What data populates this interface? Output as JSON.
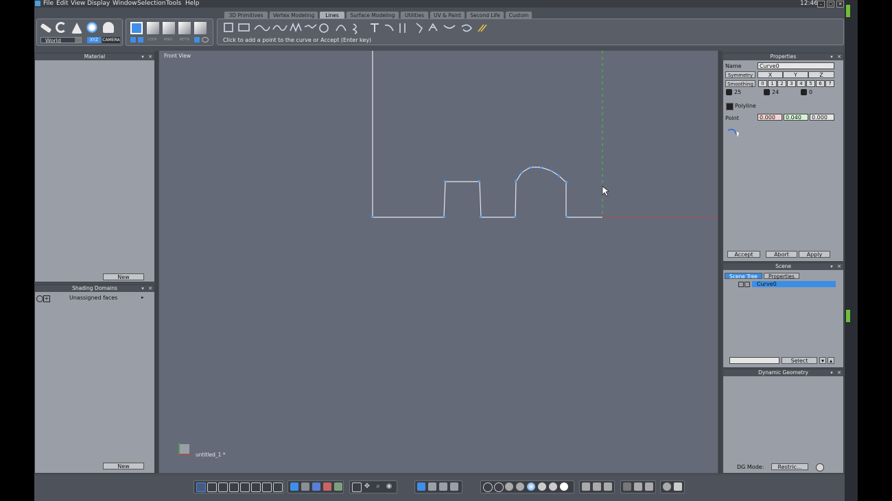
{
  "menu": {
    "items": [
      "File",
      "Edit",
      "View",
      "Display",
      "Window",
      "Selection",
      "Tools",
      "Help"
    ],
    "clock": "12:46"
  },
  "tabs": [
    "3D Primitives",
    "Vertex Modeling",
    "Lines",
    "Surface Modeling",
    "Utilities",
    "UV & Paint",
    "Second Life",
    "Custom"
  ],
  "active_tab": "Lines",
  "toolbar": {
    "space_select": "World",
    "xyz": "XYZ",
    "camera": "CAMERA",
    "loop": "LOOP",
    "ring": "RING",
    "betw": "BETW",
    "hint": "Click to add a point to the curve or Accept (Enter key)"
  },
  "material": {
    "title": "Material",
    "new_label": "New"
  },
  "shading": {
    "title": "Shading Domains",
    "item": "Unassigned faces",
    "new_label": "New"
  },
  "viewport": {
    "title": "Front View",
    "file": "untitled_1 *"
  },
  "properties": {
    "title": "Properties",
    "name_label": "Name",
    "name_value": "Curve0",
    "symmetry": "Symmetry",
    "axes": [
      "X",
      "Y",
      "Z"
    ],
    "smoothing": "Smoothing",
    "smooth_levels": [
      "0",
      "1",
      "2",
      "3",
      "4",
      "5",
      "6",
      "7"
    ],
    "counts": [
      "25",
      "24",
      "0"
    ],
    "polyline": "Polyline",
    "point_label": "Point",
    "point": [
      "0.000",
      "0.040",
      "0.000"
    ],
    "accept": "Accept",
    "abort": "Abort",
    "apply": "Apply"
  },
  "scene": {
    "title": "Scene",
    "tabs": [
      "Scene Tree",
      "Properties"
    ],
    "item": "Curve0",
    "select": "Select"
  },
  "dynamic": {
    "title": "Dynamic Geometry",
    "dg_label": "DG Mode:",
    "dg_value": "Restric..."
  },
  "colors": {
    "accent": "#3f8fe8",
    "selection": "#3a8ee6",
    "x_axis": "#d23c3c",
    "y_axis": "#3cc83c"
  }
}
